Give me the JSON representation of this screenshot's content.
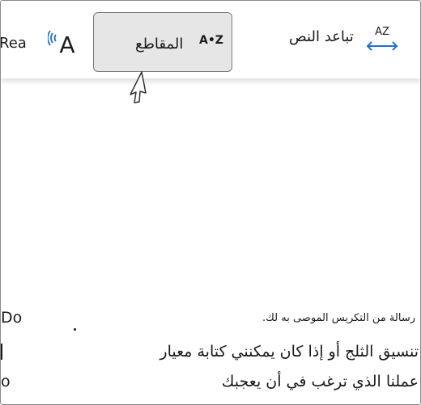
{
  "toolbar": {
    "text_spacing": {
      "label": "تباعد النص",
      "icon": "text-spacing-icon",
      "icon_letters": "AZ"
    },
    "syllables": {
      "label": "المقاطع",
      "icon": "syllables-icon",
      "icon_text": "A•Z"
    },
    "read_aloud": {
      "label": "Rea",
      "icon": "read-aloud-icon",
      "icon_letter": "A"
    }
  },
  "document": {
    "lines": [
      "رسالة من التكريس الموصى به لك.",
      "تنسيق الثلج أو إذا كان يمكنني كتابة معيار",
      "عملنا الذي ترغب في أن يعجبك"
    ],
    "left_fragments": [
      "Do",
      "o"
    ]
  },
  "colors": {
    "accent_blue": "#1f6fd0",
    "hover_bg": "#e6e6e6"
  }
}
